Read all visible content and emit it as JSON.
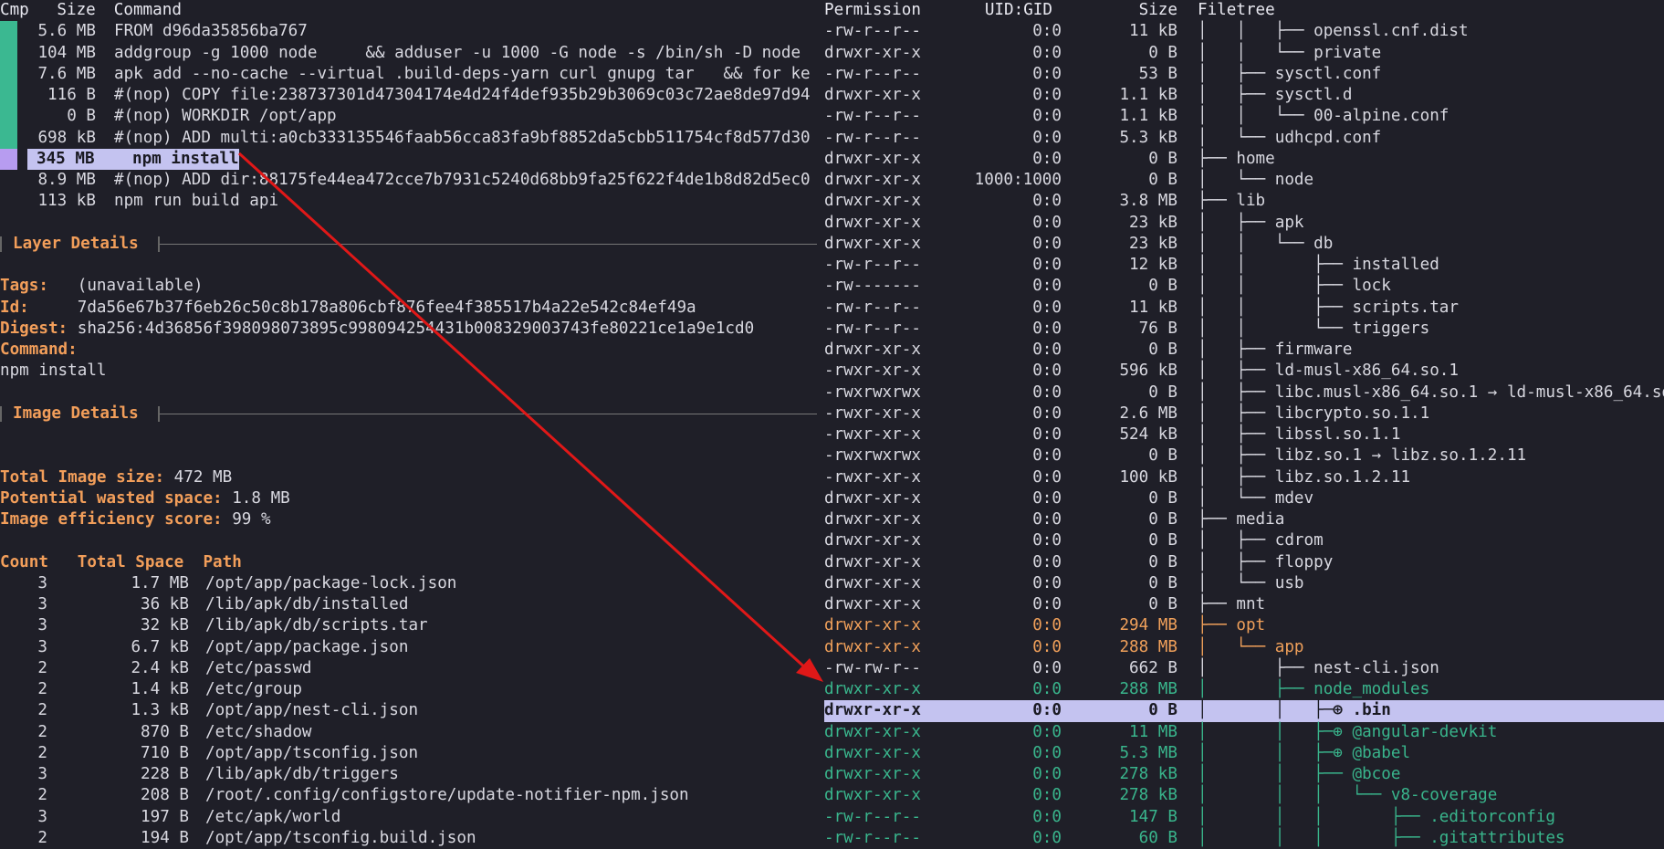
{
  "layers_header": {
    "cmp": "Cmp",
    "size": "Size",
    "command": "Command"
  },
  "layers": [
    {
      "size": "5.6 MB",
      "command": "FROM d96da35856ba767",
      "mark": "green"
    },
    {
      "size": "104 MB",
      "command": "addgroup -g 1000 node     && adduser -u 1000 -G node -s /bin/sh -D node",
      "mark": "green"
    },
    {
      "size": "7.6 MB",
      "command": "apk add --no-cache --virtual .build-deps-yarn curl gnupg tar   && for ke",
      "mark": "green"
    },
    {
      "size": "116 B",
      "command": "#(nop) COPY file:238737301d47304174e4d24f4def935b29b3069c03c72ae8de97d94",
      "mark": "green"
    },
    {
      "size": "0 B",
      "command": "#(nop) WORKDIR /opt/app",
      "mark": "green"
    },
    {
      "size": "698 kB",
      "command": "#(nop) ADD multi:a0cb333135546faab56cca83fa9bf8852da5cbb511754cf8d577d30",
      "mark": "green"
    },
    {
      "size": "345 MB",
      "command": "npm install",
      "mark": "purple",
      "selected": true
    },
    {
      "size": "8.9 MB",
      "command": "#(nop) ADD dir:88175fe44ea472cce7b7931c5240d68bb9fa25f622f4de1b8d82d5ec0",
      "mark": ""
    },
    {
      "size": "113 kB",
      "command": "npm run build api",
      "mark": ""
    }
  ],
  "layer_details": {
    "title": "Layer Details",
    "tags_label": "Tags:",
    "tags_value": "   (unavailable)",
    "id_label": "Id:",
    "id_value": "     7da56e67b37f6eb26c50c8b178a806cbf876fee4f385517b4a22e542c84ef49a",
    "digest_label": "Digest:",
    "digest_value": " sha256:4d36856f398098073895c998094254431b008329003743fe80221ce1a9e1cd0",
    "command_label": "Command:",
    "command_value": "npm install"
  },
  "image_details": {
    "title": "Image Details",
    "total_label": "Total Image size:",
    "total_value": " 472 MB",
    "wasted_label": "Potential wasted space:",
    "wasted_value": " 1.8 MB",
    "efficiency_label": "Image efficiency score:",
    "efficiency_value": " 99 %",
    "table_header": {
      "count": "Count",
      "total": "Total Space",
      "path": "Path"
    },
    "rows": [
      {
        "count": "3",
        "total": "1.7 MB",
        "path": "/opt/app/package-lock.json"
      },
      {
        "count": "3",
        "total": "36 kB",
        "path": "/lib/apk/db/installed"
      },
      {
        "count": "3",
        "total": "32 kB",
        "path": "/lib/apk/db/scripts.tar"
      },
      {
        "count": "3",
        "total": "6.7 kB",
        "path": "/opt/app/package.json"
      },
      {
        "count": "2",
        "total": "2.4 kB",
        "path": "/etc/passwd"
      },
      {
        "count": "2",
        "total": "1.4 kB",
        "path": "/etc/group"
      },
      {
        "count": "2",
        "total": "1.3 kB",
        "path": "/opt/app/nest-cli.json"
      },
      {
        "count": "2",
        "total": "870 B",
        "path": "/etc/shadow"
      },
      {
        "count": "2",
        "total": "710 B",
        "path": "/opt/app/tsconfig.json"
      },
      {
        "count": "3",
        "total": "228 B",
        "path": "/lib/apk/db/triggers"
      },
      {
        "count": "2",
        "total": "208 B",
        "path": "/root/.config/configstore/update-notifier-npm.json"
      },
      {
        "count": "3",
        "total": "197 B",
        "path": "/etc/apk/world"
      },
      {
        "count": "2",
        "total": "194 B",
        "path": "/opt/app/tsconfig.build.json"
      }
    ]
  },
  "filetree_header": {
    "permission": "Permission",
    "uidgid": "UID:GID",
    "size": "Size",
    "tree": "Filetree"
  },
  "filetree": [
    {
      "perm": "-rw-r--r--",
      "uid": "0:0",
      "size": "11 kB",
      "tree": "│   │   ├── openssl.cnf.dist",
      "state": ""
    },
    {
      "perm": "drwxr-xr-x",
      "uid": "0:0",
      "size": "0 B",
      "tree": "│   │   └── private",
      "state": ""
    },
    {
      "perm": "-rw-r--r--",
      "uid": "0:0",
      "size": "53 B",
      "tree": "│   ├── sysctl.conf",
      "state": ""
    },
    {
      "perm": "drwxr-xr-x",
      "uid": "0:0",
      "size": "1.1 kB",
      "tree": "│   ├── sysctl.d",
      "state": ""
    },
    {
      "perm": "-rw-r--r--",
      "uid": "0:0",
      "size": "1.1 kB",
      "tree": "│   │   └── 00-alpine.conf",
      "state": ""
    },
    {
      "perm": "-rw-r--r--",
      "uid": "0:0",
      "size": "5.3 kB",
      "tree": "│   └── udhcpd.conf",
      "state": ""
    },
    {
      "perm": "drwxr-xr-x",
      "uid": "0:0",
      "size": "0 B",
      "tree": "├── home",
      "state": ""
    },
    {
      "perm": "drwxr-xr-x",
      "uid": "1000:1000",
      "size": "0 B",
      "tree": "│   └── node",
      "state": ""
    },
    {
      "perm": "drwxr-xr-x",
      "uid": "0:0",
      "size": "3.8 MB",
      "tree": "├── lib",
      "state": ""
    },
    {
      "perm": "drwxr-xr-x",
      "uid": "0:0",
      "size": "23 kB",
      "tree": "│   ├── apk",
      "state": ""
    },
    {
      "perm": "drwxr-xr-x",
      "uid": "0:0",
      "size": "23 kB",
      "tree": "│   │   └── db",
      "state": ""
    },
    {
      "perm": "-rw-r--r--",
      "uid": "0:0",
      "size": "12 kB",
      "tree": "│   │       ├── installed",
      "state": ""
    },
    {
      "perm": "-rw-------",
      "uid": "0:0",
      "size": "0 B",
      "tree": "│   │       ├── lock",
      "state": ""
    },
    {
      "perm": "-rw-r--r--",
      "uid": "0:0",
      "size": "11 kB",
      "tree": "│   │       ├── scripts.tar",
      "state": ""
    },
    {
      "perm": "-rw-r--r--",
      "uid": "0:0",
      "size": "76 B",
      "tree": "│   │       └── triggers",
      "state": ""
    },
    {
      "perm": "drwxr-xr-x",
      "uid": "0:0",
      "size": "0 B",
      "tree": "│   ├── firmware",
      "state": ""
    },
    {
      "perm": "-rwxr-xr-x",
      "uid": "0:0",
      "size": "596 kB",
      "tree": "│   ├── ld-musl-x86_64.so.1",
      "state": ""
    },
    {
      "perm": "-rwxrwxrwx",
      "uid": "0:0",
      "size": "0 B",
      "tree": "│   ├── libc.musl-x86_64.so.1 → ld-musl-x86_64.so",
      "state": ""
    },
    {
      "perm": "-rwxr-xr-x",
      "uid": "0:0",
      "size": "2.6 MB",
      "tree": "│   ├── libcrypto.so.1.1",
      "state": ""
    },
    {
      "perm": "-rwxr-xr-x",
      "uid": "0:0",
      "size": "524 kB",
      "tree": "│   ├── libssl.so.1.1",
      "state": ""
    },
    {
      "perm": "-rwxrwxrwx",
      "uid": "0:0",
      "size": "0 B",
      "tree": "│   ├── libz.so.1 → libz.so.1.2.11",
      "state": ""
    },
    {
      "perm": "-rwxr-xr-x",
      "uid": "0:0",
      "size": "100 kB",
      "tree": "│   ├── libz.so.1.2.11",
      "state": ""
    },
    {
      "perm": "drwxr-xr-x",
      "uid": "0:0",
      "size": "0 B",
      "tree": "│   └── mdev",
      "state": ""
    },
    {
      "perm": "drwxr-xr-x",
      "uid": "0:0",
      "size": "0 B",
      "tree": "├── media",
      "state": ""
    },
    {
      "perm": "drwxr-xr-x",
      "uid": "0:0",
      "size": "0 B",
      "tree": "│   ├── cdrom",
      "state": ""
    },
    {
      "perm": "drwxr-xr-x",
      "uid": "0:0",
      "size": "0 B",
      "tree": "│   ├── floppy",
      "state": ""
    },
    {
      "perm": "drwxr-xr-x",
      "uid": "0:0",
      "size": "0 B",
      "tree": "│   └── usb",
      "state": ""
    },
    {
      "perm": "drwxr-xr-x",
      "uid": "0:0",
      "size": "0 B",
      "tree": "├── mnt",
      "state": ""
    },
    {
      "perm": "drwxr-xr-x",
      "uid": "0:0",
      "size": "294 MB",
      "tree": "├── opt",
      "state": "mod"
    },
    {
      "perm": "drwxr-xr-x",
      "uid": "0:0",
      "size": "288 MB",
      "tree": "│   └── app",
      "state": "mod"
    },
    {
      "perm": "-rw-rw-r--",
      "uid": "0:0",
      "size": "662 B",
      "tree": "│       ├── nest-cli.json",
      "state": ""
    },
    {
      "perm": "drwxr-xr-x",
      "uid": "0:0",
      "size": "288 MB",
      "tree": "│       ├── node_modules",
      "state": "add"
    },
    {
      "perm": "drwxr-xr-x",
      "uid": "0:0",
      "size": "0 B",
      "tree": "│       │   ├─⊕ .bin",
      "state": "sel"
    },
    {
      "perm": "drwxr-xr-x",
      "uid": "0:0",
      "size": "11 MB",
      "tree": "│       │   ├─⊕ @angular-devkit",
      "state": "add"
    },
    {
      "perm": "drwxr-xr-x",
      "uid": "0:0",
      "size": "5.3 MB",
      "tree": "│       │   ├─⊕ @babel",
      "state": "add"
    },
    {
      "perm": "drwxr-xr-x",
      "uid": "0:0",
      "size": "278 kB",
      "tree": "│       │   ├── @bcoe",
      "state": "add"
    },
    {
      "perm": "drwxr-xr-x",
      "uid": "0:0",
      "size": "278 kB",
      "tree": "│       │   │   └── v8-coverage",
      "state": "add"
    },
    {
      "perm": "-rw-r--r--",
      "uid": "0:0",
      "size": "147 B",
      "tree": "│       │   │       ├── .editorconfig",
      "state": "add"
    },
    {
      "perm": "-rw-r--r--",
      "uid": "0:0",
      "size": "60 B",
      "tree": "│       │   │       ├── .gitattributes",
      "state": "add"
    }
  ],
  "colors": {
    "added": "#39b58c",
    "modified": "#f0a05a",
    "selected_bg": "#c4c3f0",
    "arrow": "#e01818"
  }
}
